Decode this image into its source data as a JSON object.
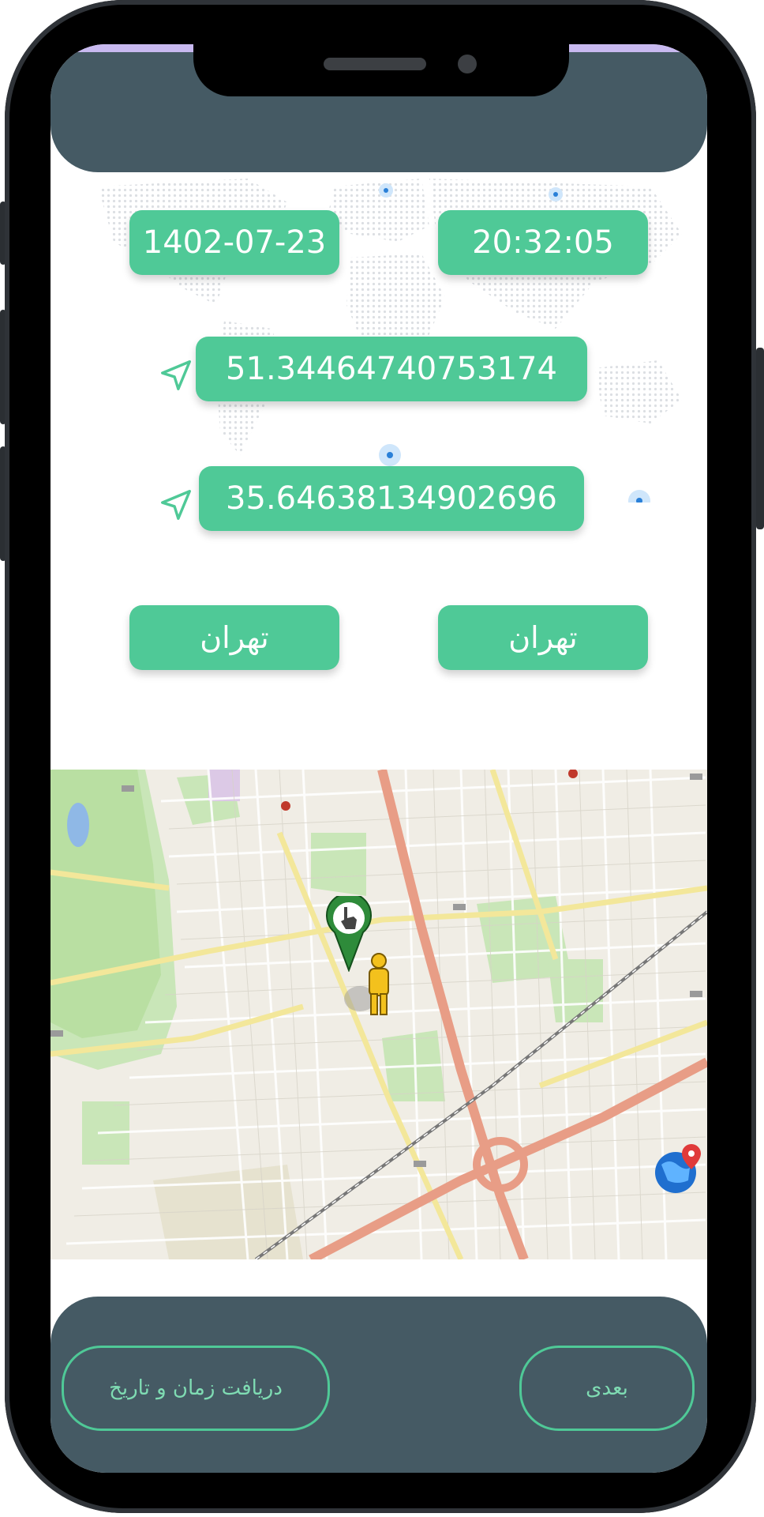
{
  "datetime": {
    "date": "1402-07-23",
    "time": "20:32:05"
  },
  "coordinates": {
    "longitude": "51.34464740753174",
    "latitude": "35.64638134902696"
  },
  "location": {
    "city_left": "تهران",
    "city_right": "تهران"
  },
  "footer": {
    "get_time_button": "دریافت زمان و تاریخ",
    "next_button": "بعدی"
  },
  "icons": {
    "nav": "navigation-arrow-icon",
    "pin": "map-pin-icon",
    "pegman": "street-view-icon",
    "globe": "globe-location-icon"
  },
  "colors": {
    "accent": "#4fc997",
    "header": "#455a64"
  }
}
